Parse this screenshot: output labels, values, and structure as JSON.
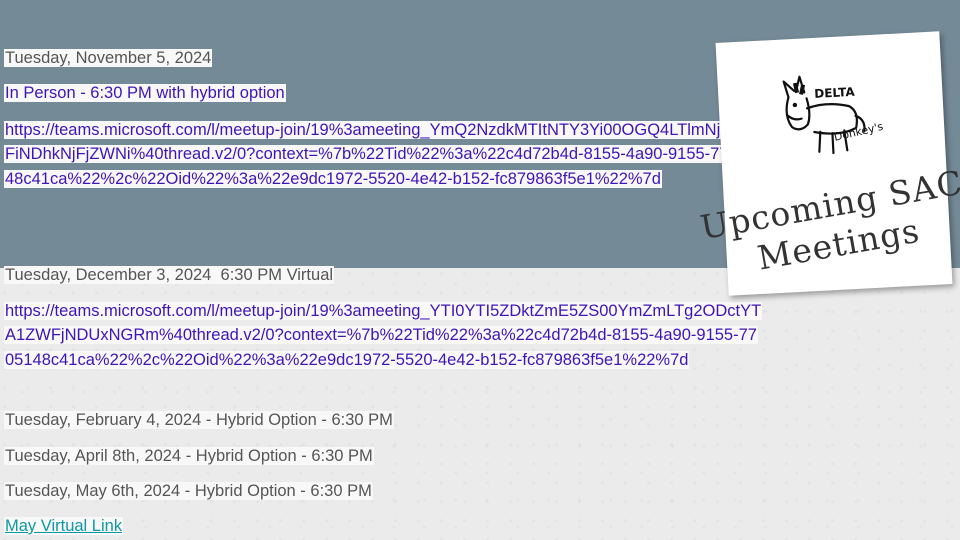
{
  "meetings": {
    "nov_date": "Tuesday, November 5, 2024",
    "nov_detail": "In Person - 6:30 PM with hybrid option",
    "nov_link": "https://teams.microsoft.com/l/meetup-join/19%3ameeting_YmQ2NzdkMTItNTY3Yi00OGQ4LTlmNjYtNmFiNDhkNjFjZWNi%40thread.v2/0?context=%7b%22Tid%22%3a%22c4d72b4d-8155-4a90-9155-7705148c41ca%22%2c%22Oid%22%3a%22e9dc1972-5520-4e42-b152-fc879863f5e1%22%7d",
    "dec_line": "Tuesday, December 3, 2024  6:30 PM Virtual",
    "dec_link": "https://teams.microsoft.com/l/meetup-join/19%3ameeting_YTI0YTI5ZDktZmE5ZS00YmZmLTg2ODctYTA1ZWFjNDUxNGRm%40thread.v2/0?context=%7b%22Tid%22%3a%22c4d72b4d-8155-4a90-9155-7705148c41ca%22%2c%22Oid%22%3a%22e9dc1972-5520-4e42-b152-fc879863f5e1%22%7d",
    "feb_line": "Tuesday, February 4, 2024 - Hybrid Option - 6:30 PM",
    "apr_line": "Tuesday, April 8th, 2024 - Hybrid Option - 6:30 PM",
    "may_line": "Tuesday, May 6th, 2024 - Hybrid Option - 6:30 PM",
    "may_link_label": "May Virtual Link"
  },
  "card": {
    "logo_text_top": "DELTA",
    "logo_text_bottom": "Donkey's",
    "title_line1": "Upcoming SAC",
    "title_line2": "Meetings"
  },
  "colors": {
    "top_band": "#748a97",
    "link_purple": "#3f14b8",
    "link_teal": "#0c98a3",
    "text_gray": "#555555"
  }
}
